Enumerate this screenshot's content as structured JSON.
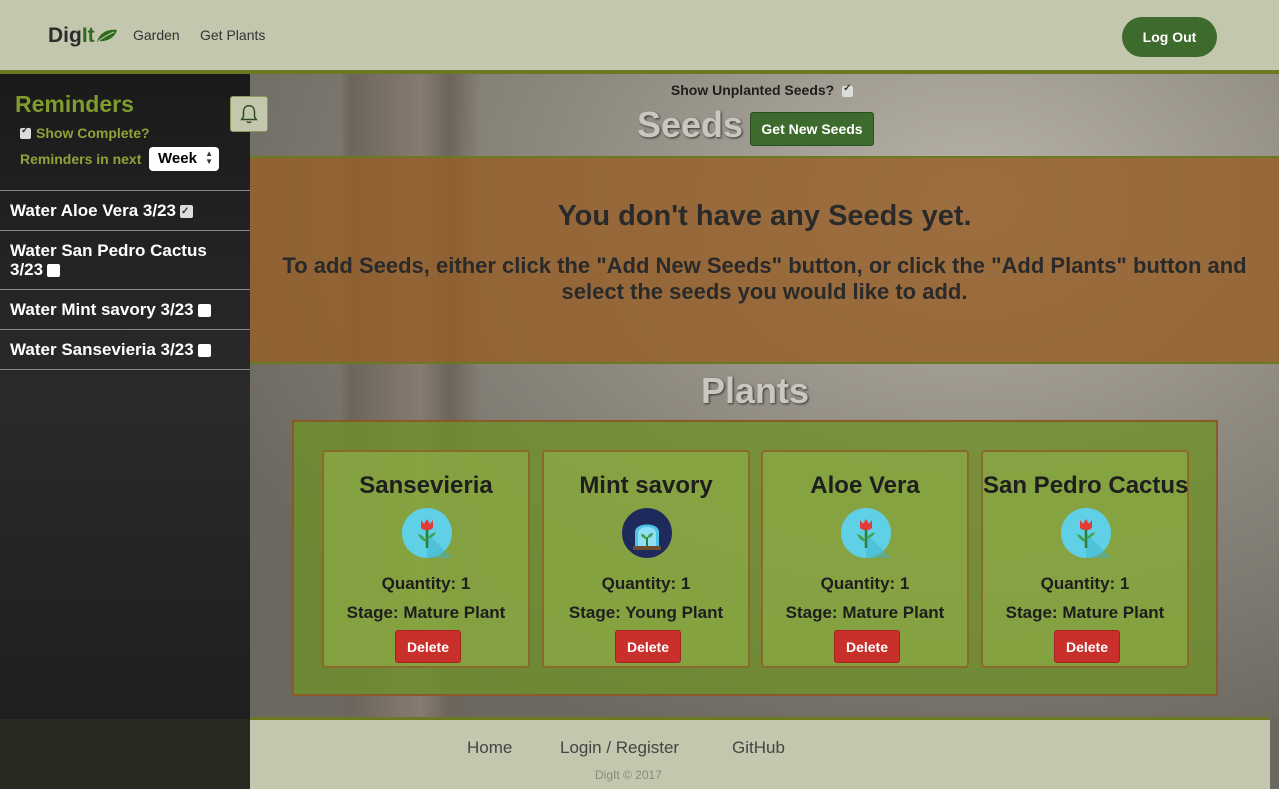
{
  "header": {
    "brand_text": "Dig",
    "brand_accent": "It",
    "nav_items": [
      "Garden",
      "Get Plants"
    ],
    "logout_label": "Log Out"
  },
  "sidebar": {
    "title": "Reminders",
    "show_complete_label": "Show Complete?",
    "show_complete_checked": true,
    "reminders_in_next_label": "Reminders in next",
    "period_value": "Week",
    "bell_icon": "bell-icon",
    "reminders": [
      {
        "text": "Water Aloe Vera 3/23",
        "checked": true
      },
      {
        "text": "Water San Pedro Cactus 3/23",
        "checked": false
      },
      {
        "text": "Water Mint savory 3/23",
        "checked": false
      },
      {
        "text": "Water Sansevieria 3/23",
        "checked": false
      }
    ]
  },
  "seeds": {
    "show_unplanted_label": "Show Unplanted Seeds?",
    "show_unplanted_checked": true,
    "title": "Seeds",
    "get_new_label": "Get New Seeds",
    "empty_title": "You don't have any Seeds yet.",
    "empty_text": "To add Seeds, either click the \"Add New Seeds\" button, or click the \"Add Plants\" button and select the seeds you would like to add."
  },
  "plants": {
    "title": "Plants",
    "cards": [
      {
        "name": "Sansevieria",
        "icon": "flower-icon",
        "quantity": "Quantity: 1",
        "stage": "Stage: Mature Plant",
        "delete_label": "Delete"
      },
      {
        "name": "Mint savory",
        "icon": "greenhouse-seedling-icon",
        "quantity": "Quantity: 1",
        "stage": "Stage: Young Plant",
        "delete_label": "Delete"
      },
      {
        "name": "Aloe Vera",
        "icon": "flower-icon",
        "quantity": "Quantity: 1",
        "stage": "Stage: Mature Plant",
        "delete_label": "Delete"
      },
      {
        "name": "San Pedro Cactus",
        "icon": "flower-icon",
        "quantity": "Quantity: 1",
        "stage": "Stage: Mature Plant",
        "delete_label": "Delete"
      }
    ]
  },
  "footer": {
    "links": [
      "Home",
      "Login / Register",
      "GitHub"
    ],
    "copyright": "DigIt © 2017"
  },
  "colors": {
    "nav_bg": "#c2c7ad",
    "accent_green": "#3d6b2e",
    "olive_border": "#6b7a22",
    "delete_red": "#c9302c"
  }
}
